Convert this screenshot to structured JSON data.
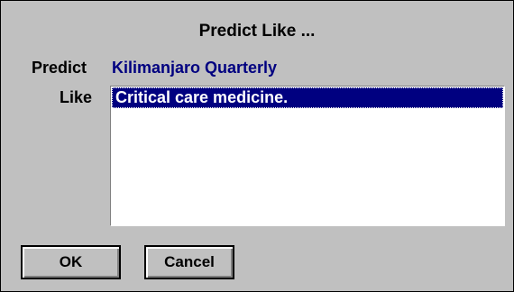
{
  "dialog": {
    "title": "Predict Like ...",
    "predict_label": "Predict",
    "predict_value": "Kilimanjaro Quarterly",
    "like_label": "Like",
    "like_items": [
      {
        "label": "Critical care medicine.",
        "selected": true
      }
    ],
    "ok_label": "OK",
    "cancel_label": "Cancel"
  },
  "colors": {
    "dialog_background": "#c0c0c0",
    "selection_background": "#000080",
    "value_text": "#000080"
  }
}
